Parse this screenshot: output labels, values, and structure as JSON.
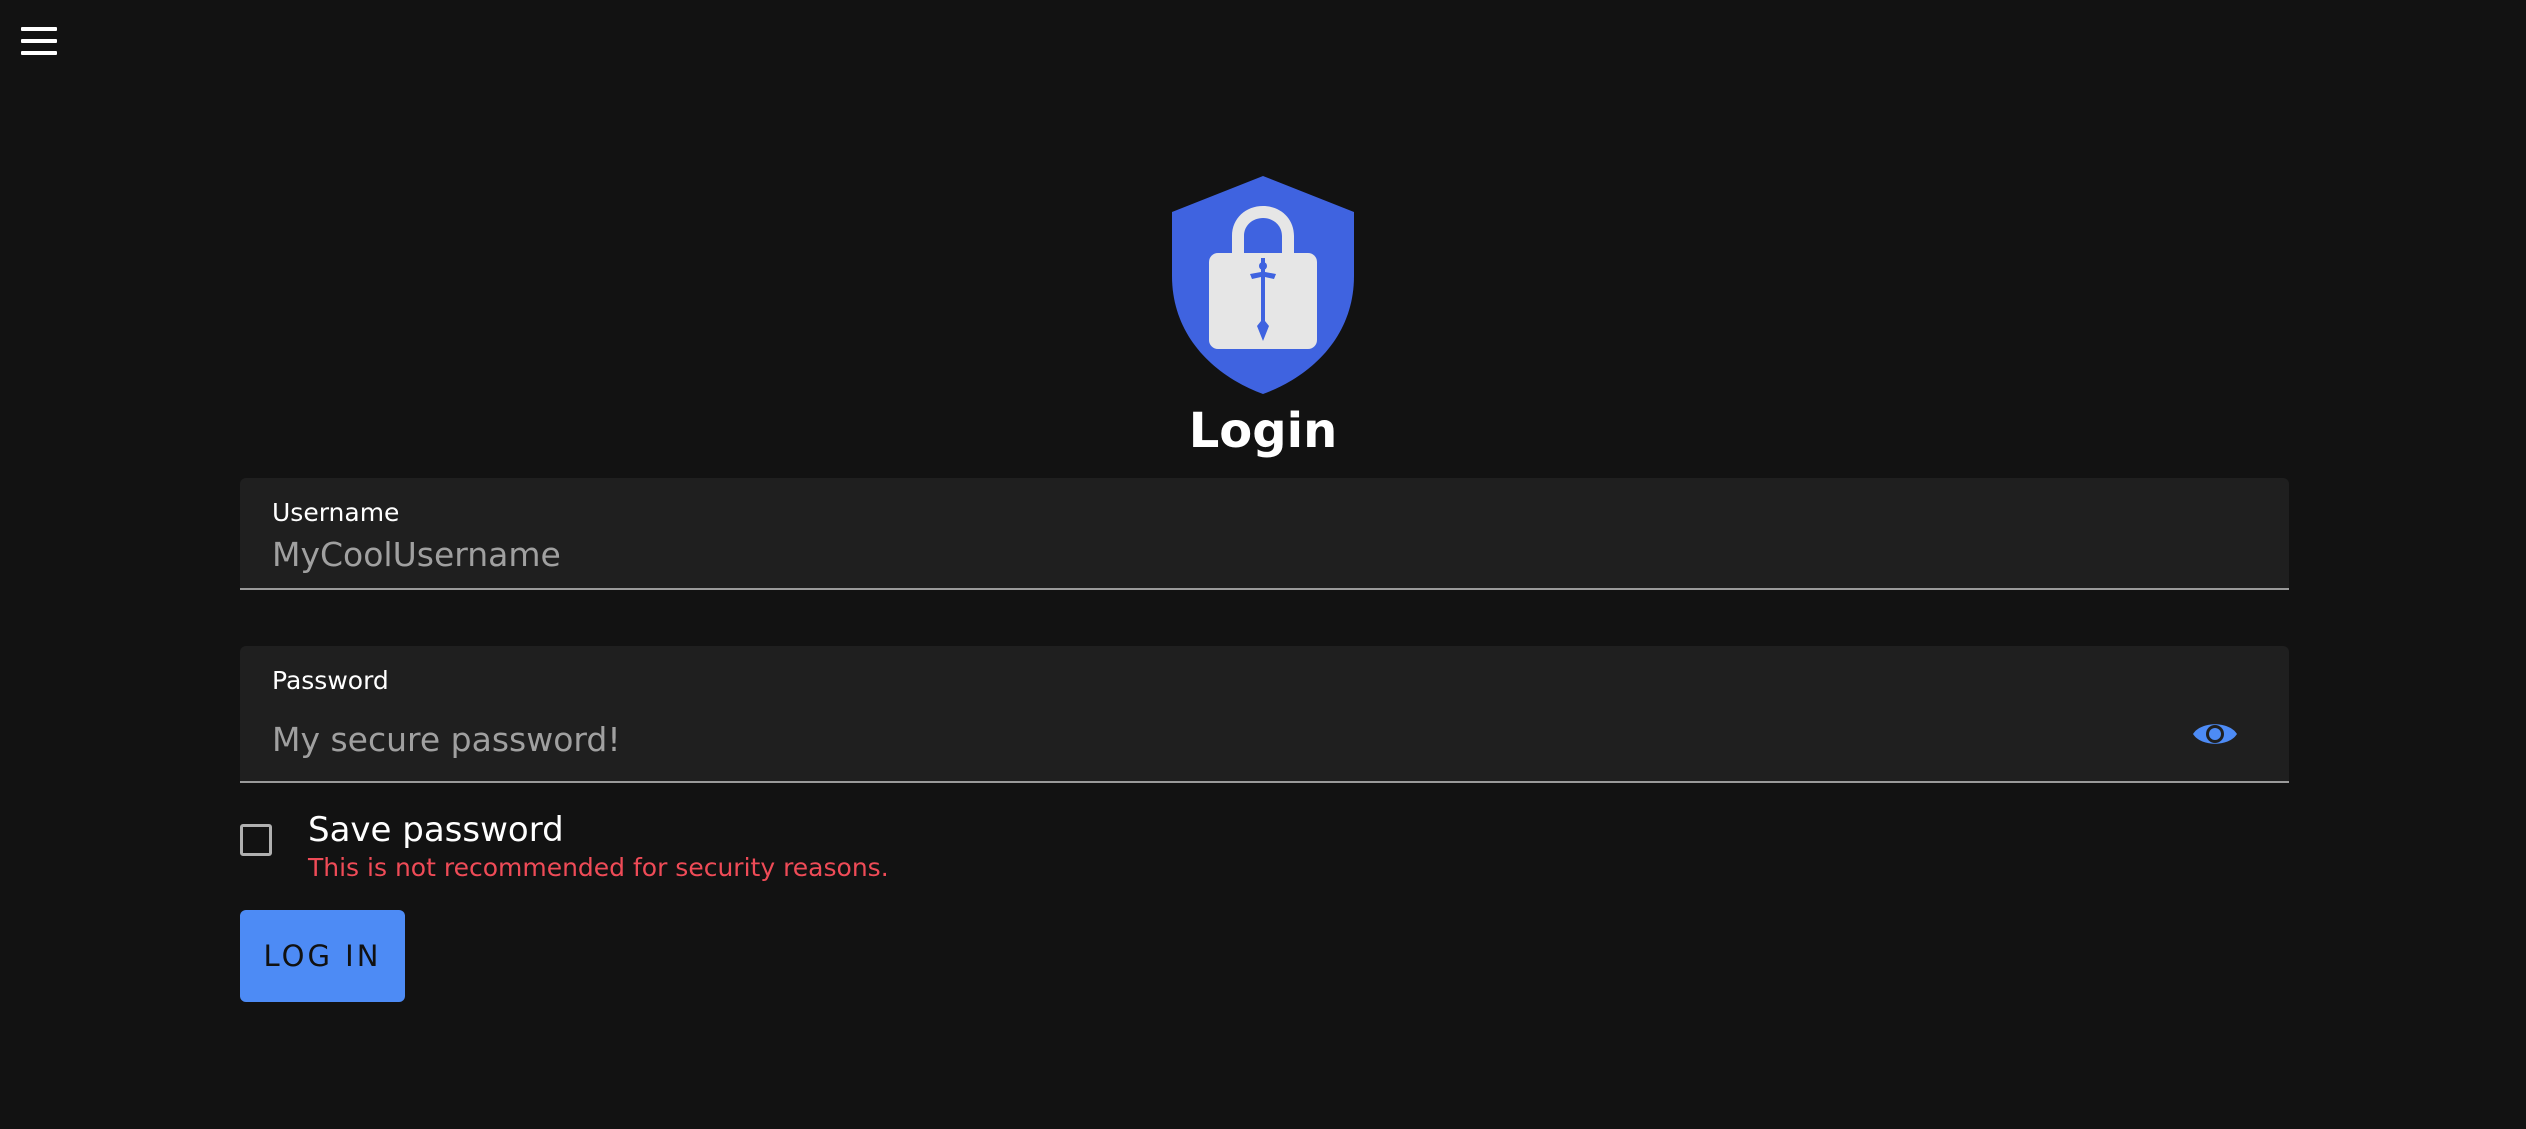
{
  "header": {
    "menu_icon": "hamburger-menu-icon"
  },
  "logo": {
    "icon": "shield-lock-sword-icon",
    "shield_color": "#3f63e0",
    "lock_color": "#e6e6e6"
  },
  "form": {
    "title": "Login",
    "username": {
      "label": "Username",
      "placeholder": "MyCoolUsername",
      "value": ""
    },
    "password": {
      "label": "Password",
      "placeholder": "My secure password!",
      "value": "",
      "toggle_icon": "eye-icon"
    },
    "save_password": {
      "label": "Save password",
      "checked": false,
      "warning": "This is not recommended for security reasons."
    },
    "submit_label": "LOG IN"
  },
  "colors": {
    "background": "#121212",
    "field_background": "#1f1f1f",
    "accent": "#4d8bf5",
    "warning": "#ef4b57"
  }
}
